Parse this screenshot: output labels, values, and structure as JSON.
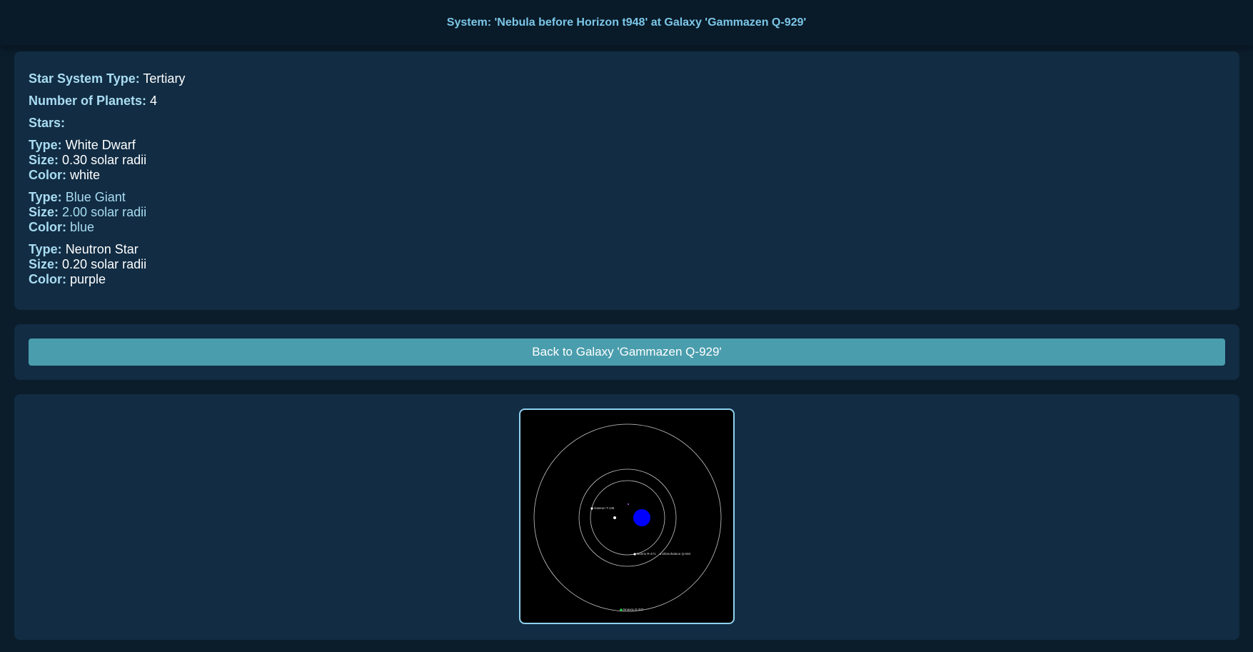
{
  "header": {
    "title": "System: 'Nebula before Horizon t948' at Galaxy 'Gammazen Q-929'"
  },
  "info": {
    "system_type_label": "Star System Type:",
    "system_type_value": "Tertiary",
    "planet_count_label": "Number of Planets:",
    "planet_count_value": "4",
    "stars_label": "Stars:",
    "stars": [
      {
        "type_label": "Type:",
        "type": "White Dwarf",
        "size_label": "Size:",
        "size": "0.30 solar radii",
        "color_label": "Color:",
        "color": "white"
      },
      {
        "type_label": "Type:",
        "type": "Blue Giant",
        "size_label": "Size:",
        "size": "2.00 solar radii",
        "color_label": "Color:",
        "color": "blue"
      },
      {
        "type_label": "Type:",
        "type": "Neutron Star",
        "size_label": "Size:",
        "size": "0.20 solar radii",
        "color_label": "Color:",
        "color": "purple"
      }
    ]
  },
  "nav": {
    "back_label": "Back to Galaxy 'Gammazen Q-929'"
  },
  "orbit_map": {
    "planets": [
      {
        "name": "Gaseon T-136"
      },
      {
        "name": "Nonrix R-471"
      },
      {
        "name": "Ultimohaleon Q-040"
      },
      {
        "name": "Nnaxra O-337"
      }
    ],
    "colors": {
      "white_star": "#ffffff",
      "blue_star": "#0000ff",
      "neutron_star": "#b060ff",
      "orbit": "#c8c8c8",
      "planet_green": "#22cc44"
    }
  }
}
